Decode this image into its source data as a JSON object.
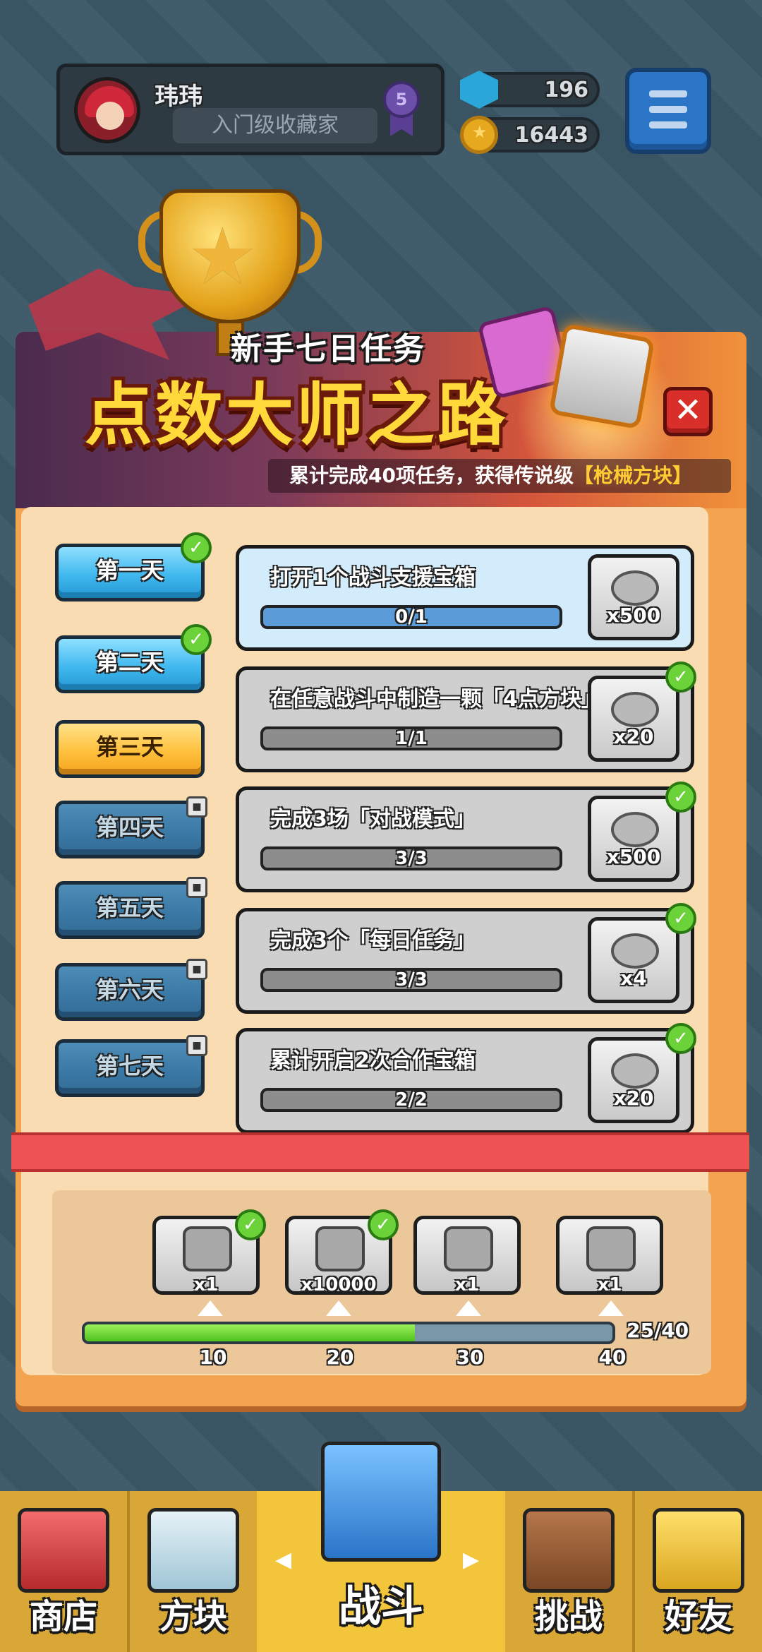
{
  "player": {
    "name": "玮玮",
    "title": "入门级收藏家",
    "rank": "5"
  },
  "resources": {
    "gems": "196",
    "coins": "16443"
  },
  "banner": {
    "subtitle": "新手七日任务",
    "title": "点数大师之路",
    "desc_prefix": "累计完成40项任务，获得传说级",
    "desc_highlight": "【枪械方块】"
  },
  "days": [
    {
      "label": "第一天",
      "state": "done"
    },
    {
      "label": "第二天",
      "state": "done"
    },
    {
      "label": "第三天",
      "state": "active"
    },
    {
      "label": "第四天",
      "state": "locked"
    },
    {
      "label": "第五天",
      "state": "locked"
    },
    {
      "label": "第六天",
      "state": "locked"
    },
    {
      "label": "第七天",
      "state": "locked"
    }
  ],
  "tasks": [
    {
      "title": "打开1个战斗支援宝箱",
      "progress": "0/1",
      "fraction": 0,
      "reward": "x500",
      "done": false
    },
    {
      "title": "在任意战斗中制造一颗「4点方块」",
      "progress": "1/1",
      "fraction": 1,
      "reward": "x20",
      "done": true
    },
    {
      "title": "完成3场「对战模式」",
      "progress": "3/3",
      "fraction": 1,
      "reward": "x500",
      "done": true
    },
    {
      "title": "完成3个「每日任务」",
      "progress": "3/3",
      "fraction": 1,
      "reward": "x4",
      "done": true
    },
    {
      "title": "累计开启2次合作宝箱",
      "progress": "2/2",
      "fraction": 1,
      "reward": "x20",
      "done": true
    }
  ],
  "milestones": {
    "rewards": [
      {
        "qty": "x1",
        "claimed": true
      },
      {
        "qty": "x10000",
        "claimed": true
      },
      {
        "qty": "x1",
        "claimed": false
      },
      {
        "qty": "x1",
        "claimed": false
      }
    ],
    "marks": [
      "10",
      "20",
      "30",
      "40"
    ],
    "progress_text": "25/40",
    "progress_fraction": 0.625
  },
  "nav": {
    "shop": "商店",
    "blocks": "方块",
    "battle": "战斗",
    "challenge": "挑战",
    "friends": "好友"
  }
}
